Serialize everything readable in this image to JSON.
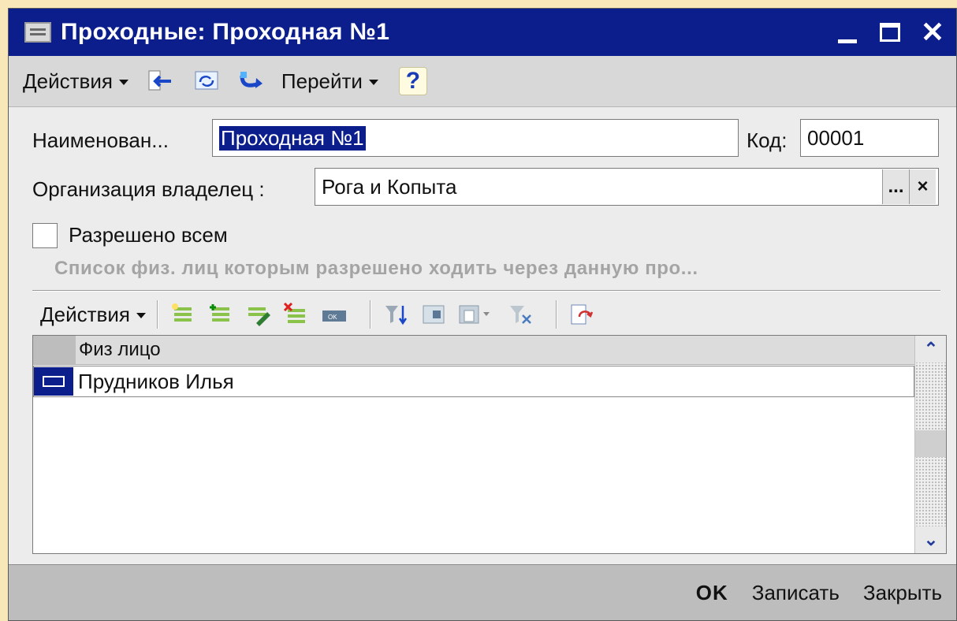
{
  "window": {
    "title": "Проходные: Проходная №1"
  },
  "toolbar": {
    "actions_label": "Действия",
    "goto_label": "Перейти",
    "help_label": "?"
  },
  "form": {
    "name_label": "Наименован...",
    "name_value": "Проходная №1",
    "code_label": "Код:",
    "code_value": "00001",
    "org_label": "Организация владелец :",
    "org_value": "Рога и Копыта",
    "select_btn": "...",
    "clear_btn": "×",
    "allow_all_label": "Разрешено всем",
    "allow_all_checked": false
  },
  "section": {
    "title": "Список физ. лиц которым разрешено ходить через данную  про..."
  },
  "table_toolbar": {
    "actions_label": "Действия"
  },
  "table": {
    "columns": [
      "Физ лицо"
    ],
    "rows": [
      [
        "Прудников Илья"
      ]
    ]
  },
  "footer": {
    "ok_label": "OK",
    "save_label": "Записать",
    "close_label": "Закрыть"
  },
  "colors": {
    "titlebar": "#0b1e8c",
    "background": "#f8e7b8"
  }
}
